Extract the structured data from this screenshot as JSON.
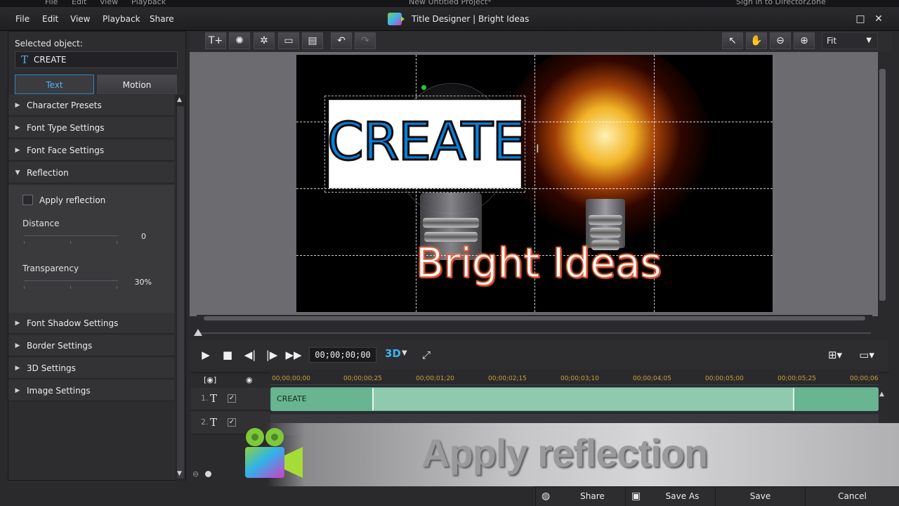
{
  "background_app": {
    "menu": [
      "File",
      "Edit",
      "View",
      "Playback"
    ],
    "project_title": "New Untitled Project*",
    "sign_in": "Sign in to DirectorZone"
  },
  "titlebar": {
    "menu": [
      "File",
      "Edit",
      "View",
      "Playback",
      "Share"
    ],
    "title": "Title Designer  |  Bright Ideas"
  },
  "left_panel": {
    "selected_label": "Selected object:",
    "selected_name": "CREATE",
    "tabs": {
      "text": "Text",
      "motion": "Motion"
    },
    "sections": [
      "Character Presets",
      "Font Type Settings",
      "Font Face Settings",
      "Reflection",
      "Font Shadow Settings",
      "Border Settings",
      "3D Settings",
      "Image Settings"
    ],
    "reflection": {
      "apply_label": "Apply reflection",
      "distance_label": "Distance",
      "distance_value": "0",
      "transparency_label": "Transparency",
      "transparency_value": "30%"
    }
  },
  "toolbar": {
    "zoom_value": "Fit"
  },
  "canvas": {
    "title1": "CREATE",
    "title2": "Bright Ideas"
  },
  "playback": {
    "timecode": "00;00;00;00",
    "mode_3d": "3D"
  },
  "timeline": {
    "ruler": [
      "00;00;00;00",
      "00;00;00;25",
      "00;00;01;20",
      "00;00;02;15",
      "00;00;03;10",
      "00;00;04;05",
      "00;00;05;00",
      "00;00;05;25",
      "00;00;06"
    ],
    "tracks": [
      {
        "num": "1.",
        "clip": "CREATE"
      },
      {
        "num": "2.",
        "clip": ""
      }
    ]
  },
  "watermark": {
    "text": "Apply reflection"
  },
  "bottom": {
    "share": "Share",
    "save_as": "Save As",
    "save": "Save",
    "cancel": "Cancel"
  },
  "colors": {
    "accent": "#2f86c8",
    "clip": "#8ecaad",
    "create_text": "#0a7fd9"
  }
}
